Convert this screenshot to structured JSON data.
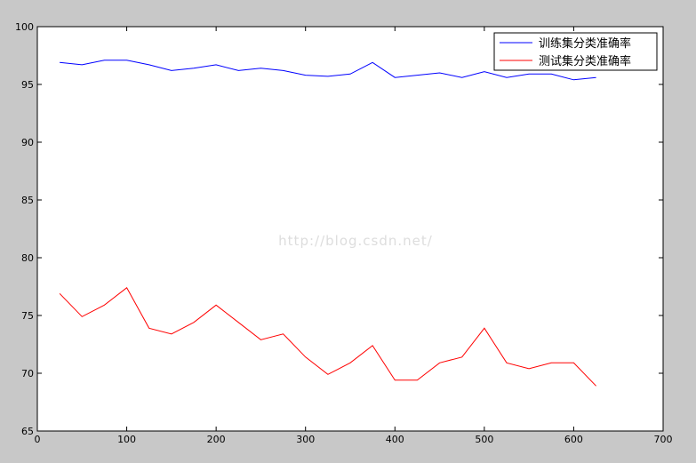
{
  "chart_data": {
    "type": "line",
    "xlim": [
      0,
      700
    ],
    "ylim": [
      65,
      100
    ],
    "xticks": [
      0,
      100,
      200,
      300,
      400,
      500,
      600,
      700
    ],
    "yticks": [
      65,
      70,
      75,
      80,
      85,
      90,
      95,
      100
    ],
    "grid": false,
    "legend_position": "top-right",
    "watermark": "http://blog.csdn.net/",
    "x": [
      25,
      50,
      75,
      100,
      125,
      150,
      175,
      200,
      225,
      250,
      275,
      300,
      325,
      350,
      375,
      400,
      425,
      450,
      475,
      500,
      525,
      550,
      575,
      600,
      625
    ],
    "series": [
      {
        "name": "训练集分类准确率",
        "color": "#0000ff",
        "values": [
          96.9,
          96.7,
          97.1,
          97.1,
          96.7,
          96.2,
          96.4,
          96.7,
          96.2,
          96.4,
          96.2,
          95.8,
          95.7,
          95.9,
          96.9,
          95.6,
          95.8,
          96.0,
          95.6,
          96.1,
          95.6,
          95.9,
          95.9,
          95.4,
          95.6
        ]
      },
      {
        "name": "测试集分类准确率",
        "color": "#ff0000",
        "values": [
          76.9,
          74.9,
          75.9,
          77.4,
          73.9,
          73.4,
          74.4,
          75.9,
          74.4,
          72.9,
          73.4,
          71.4,
          69.9,
          70.9,
          72.4,
          69.4,
          69.4,
          70.9,
          71.4,
          73.9,
          70.9,
          70.4,
          70.9,
          70.9,
          68.9
        ]
      }
    ]
  }
}
